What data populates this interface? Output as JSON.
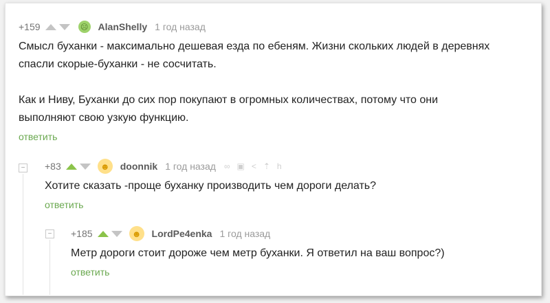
{
  "comments": [
    {
      "rating": "+159",
      "username": "AlanShelly",
      "time": "1 год назад",
      "avatar_icon": "green-face-icon",
      "paragraphs": [
        "Смысл буханки - максимально дешевая езда по ебеням. Жизни скольких людей в деревнях",
        "спасли скорые-буханки - не сосчитать.",
        "",
        "Как и Ниву, Буханки до сих пор покупают в огромных количествах, потому что они",
        "выполняют свою узкую функцию."
      ],
      "reply_label": "ответить"
    },
    {
      "rating": "+83",
      "username": "doonnik",
      "time": "1 год назад",
      "avatar_icon": "yellow-face-icon",
      "paragraphs": [
        "Хотите сказать -проще буханку производить чем дороги делать?"
      ],
      "reply_label": "ответить"
    },
    {
      "rating": "+185",
      "username": "LordPe4enka",
      "time": "1 год назад",
      "avatar_icon": "yellow-face-icon",
      "paragraphs": [
        "Метр дороги стоит дороже чем метр буханки. Я ответил на ваш вопрос?)"
      ],
      "reply_label": "ответить"
    }
  ],
  "colors": {
    "accent": "#6aa84f",
    "upvote_active": "#8bc34a",
    "text": "#222222",
    "muted": "#9a9a9a"
  }
}
